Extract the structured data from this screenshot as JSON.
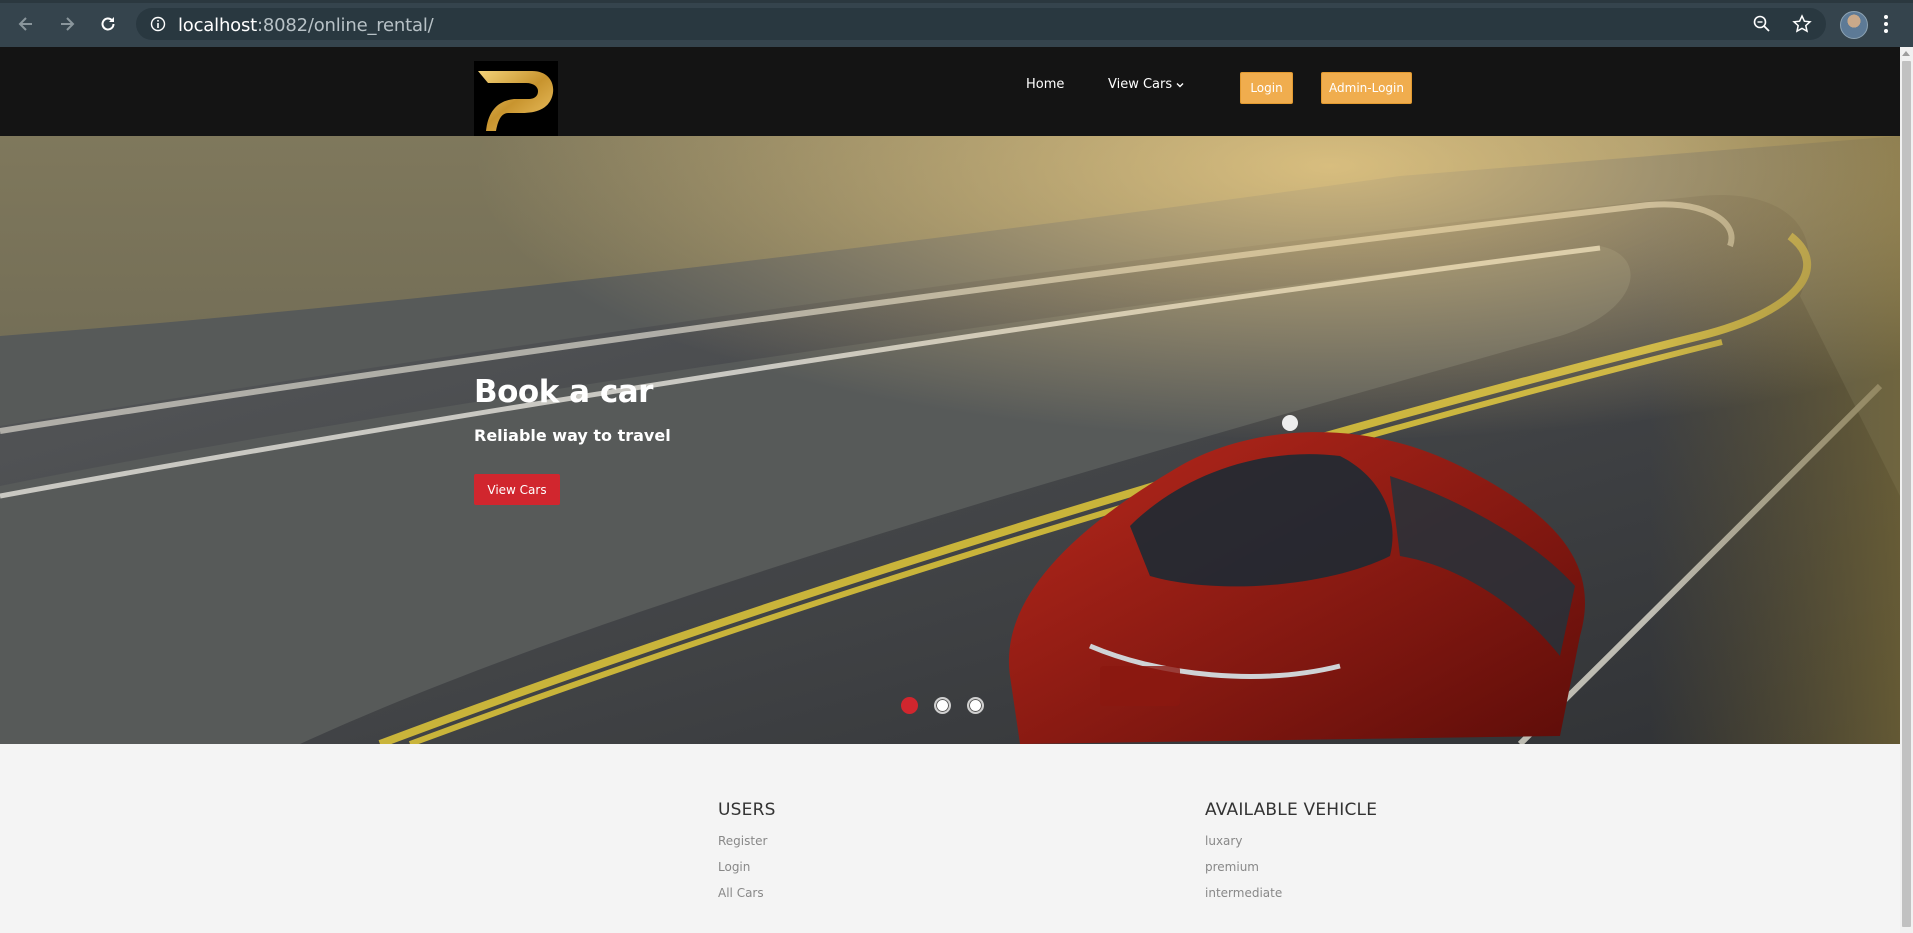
{
  "browser": {
    "url_host": "localhost",
    "url_rest": ":8082/online_rental/",
    "icons": [
      "back-arrow-icon",
      "forward-arrow-icon",
      "reload-icon",
      "site-info-icon",
      "zoom-icon",
      "star-icon",
      "avatar",
      "menu-kebab-icon"
    ]
  },
  "header": {
    "nav": {
      "home": "Home",
      "view_cars": "View Cars"
    },
    "buttons": {
      "login": "Login",
      "admin_login": "Admin-Login"
    }
  },
  "hero": {
    "title": "Book a car",
    "subtitle": "Reliable way to travel",
    "button": "View Cars",
    "slides": {
      "count": 3,
      "active": 1
    }
  },
  "footer": {
    "users": {
      "heading": "USERS",
      "links": [
        "Register",
        "Login",
        "All Cars"
      ]
    },
    "vehicles": {
      "heading": "AVAILABLE VEHICLE",
      "links": [
        "luxary",
        "premium",
        "intermediate"
      ]
    }
  },
  "colors": {
    "accent_red": "#d1262e",
    "accent_gold": "#f0ad4e",
    "header_bg": "#141414",
    "chrome_bg": "#35444d"
  }
}
